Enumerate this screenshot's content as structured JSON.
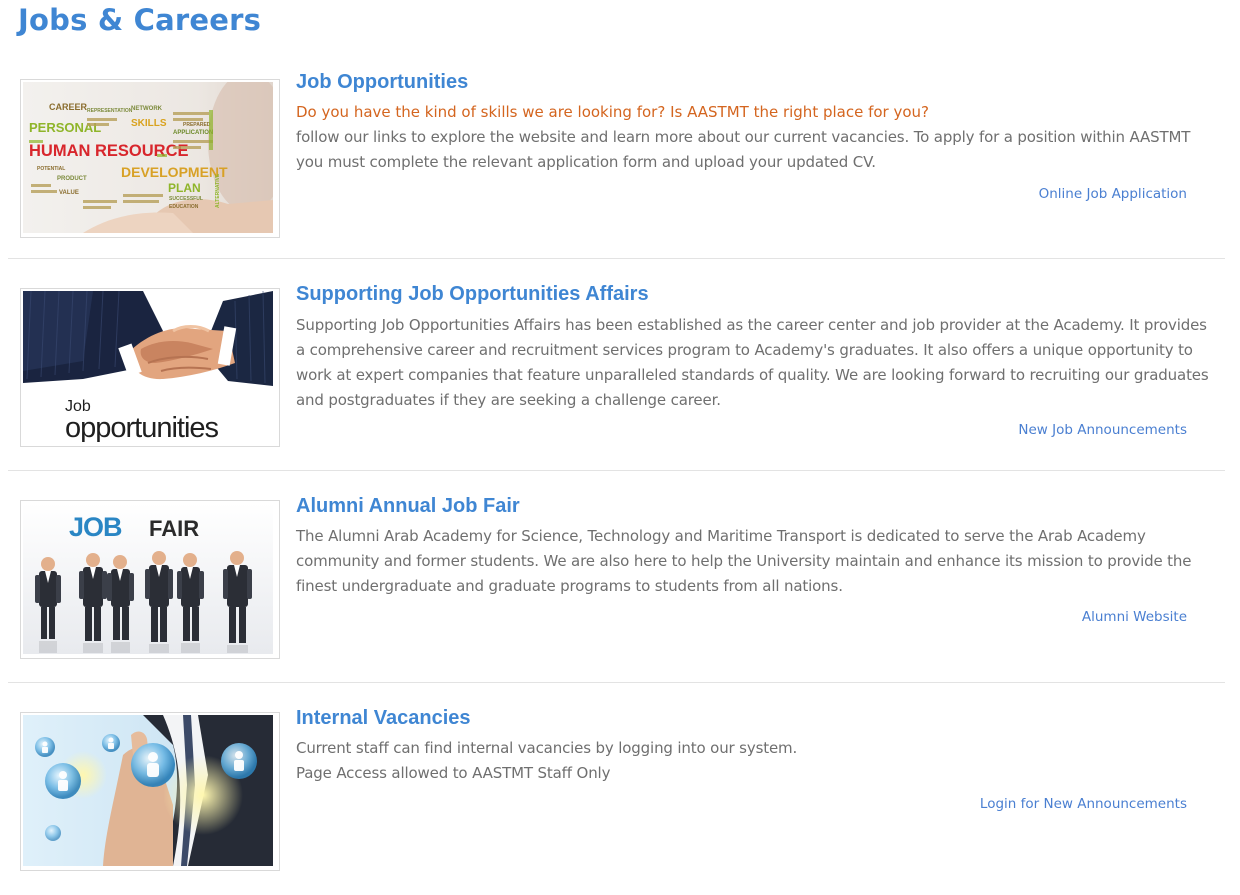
{
  "page": {
    "title": "Jobs & Careers"
  },
  "entries": [
    {
      "title": "Job Opportunities",
      "tagline": "Do you have the kind of skills we are looking for? Is AASTMT the right place for you?",
      "body": "follow our links to explore the website and learn more about our current vacancies. To apply for a position within AASTMT you must complete the relevant application form and upload your updated CV.",
      "link": "Online Job Application",
      "image_text": [
        "CAREER",
        "PERSONAL",
        "SKILLS",
        "HUMAN RESOURCE",
        "DEVELOPMENT",
        "PLAN",
        "REPRESENTATION",
        "APPLICATION",
        "NETWORK",
        "POTENTIAL",
        "PRODUCT",
        "VALUE",
        "SUCCESSFUL",
        "EDUCATION",
        "ALTERNATIVE",
        "PREPARED"
      ]
    },
    {
      "title": "Supporting Job Opportunities Affairs",
      "body": "Supporting Job Opportunities Affairs has been established as the career center and job provider at the Academy. It provides a comprehensive career and recruitment services program to Academy's graduates. It also offers a unique opportunity to work at expert companies that feature unparalleled standards of quality. We are looking forward to recruiting our graduates and postgraduates if they are seeking a challenge career.",
      "link": "New Job Announcements",
      "image_text": [
        "Job",
        "opportunities"
      ]
    },
    {
      "title": "Alumni Annual Job Fair",
      "body": "The Alumni Arab Academy for Science, Technology and Maritime Transport is dedicated to serve the Arab Academy community and former students. We are also here to help the University maintain and enhance its mission to provide the finest undergraduate and graduate programs to students from all nations.",
      "link": "Alumni Website",
      "image_text": [
        "JOB",
        "FAIR"
      ]
    },
    {
      "title": "Internal Vacancies",
      "body_lines": [
        "Current staff can find internal vacancies by logging into our system.",
        "Page Access allowed to AASTMT Staff Only"
      ],
      "link": "Login for New Announcements"
    }
  ],
  "colors": {
    "heading": "#3f86d3",
    "tagline": "#d4651f",
    "body_text": "#6f6f6f",
    "link": "#4a7fd1",
    "divider": "#e3e3e3"
  }
}
